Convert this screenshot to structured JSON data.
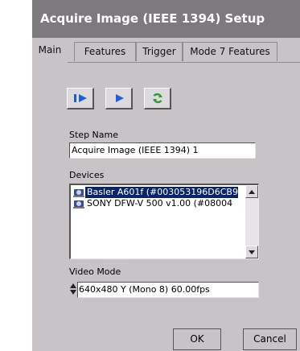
{
  "window": {
    "title": "Acquire Image (IEEE 1394) Setup"
  },
  "tabs": [
    {
      "label": "Main",
      "active": true
    },
    {
      "label": "Features",
      "active": false
    },
    {
      "label": "Trigger",
      "active": false
    },
    {
      "label": "Mode 7 Features",
      "active": false
    }
  ],
  "toolbar": {
    "buttons": [
      {
        "icon": "step-run-icon"
      },
      {
        "icon": "run-icon"
      },
      {
        "icon": "refresh-icon"
      }
    ],
    "colors": {
      "arrow": "#1f5fd6",
      "refresh": "#2e9a2e"
    }
  },
  "step_name": {
    "label": "Step Name",
    "value": "Acquire Image (IEEE 1394) 1"
  },
  "devices": {
    "label": "Devices",
    "items": [
      {
        "label": "Basler A601f (#003053196D6CB9",
        "selected": true,
        "icon": "camera-icon"
      },
      {
        "label": "SONY DFW-V 500 v1.00  (#08004",
        "selected": false,
        "icon": "camera-icon"
      }
    ]
  },
  "video_mode": {
    "label": "Video Mode",
    "value": "640x480 Y (Mono 8) 60.00fps"
  },
  "buttons": {
    "ok": "OK",
    "cancel": "Cancel"
  }
}
